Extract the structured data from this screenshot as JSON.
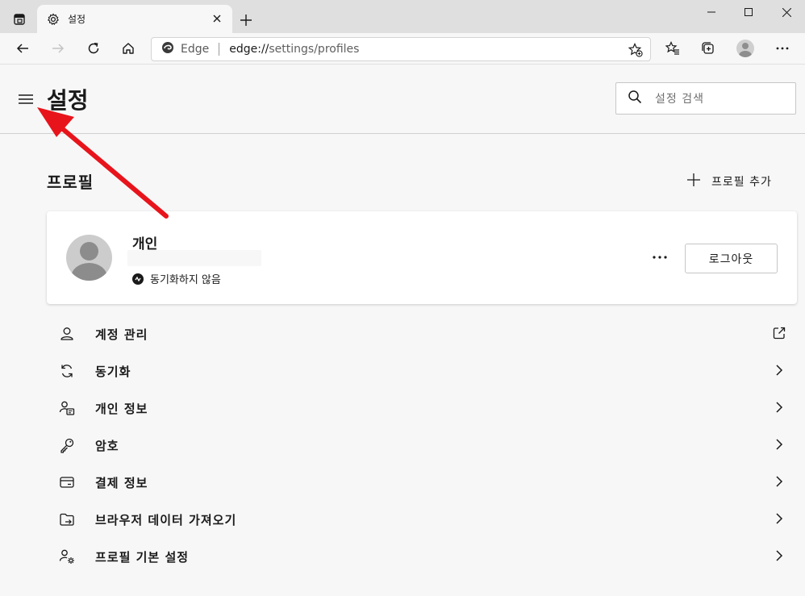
{
  "browser": {
    "tab": {
      "title": "설정"
    },
    "address": {
      "site_name": "Edge",
      "url_scheme": "edge://",
      "url_path": "settings/profiles"
    }
  },
  "header": {
    "title": "설정",
    "search_placeholder": "설정 검색"
  },
  "profiles": {
    "section_title": "프로필",
    "add_label": "프로필 추가",
    "card": {
      "name": "개인",
      "sync_status": "동기화하지 않음",
      "logout_label": "로그아웃"
    },
    "items": [
      {
        "label": "계정 관리",
        "icon": "account-icon",
        "action": "external-link-icon"
      },
      {
        "label": "동기화",
        "icon": "sync-icon",
        "action": "chevron-right-icon"
      },
      {
        "label": "개인 정보",
        "icon": "personal-info-icon",
        "action": "chevron-right-icon"
      },
      {
        "label": "암호",
        "icon": "key-icon",
        "action": "chevron-right-icon"
      },
      {
        "label": "결제 정보",
        "icon": "card-icon",
        "action": "chevron-right-icon"
      },
      {
        "label": "브라우저 데이터 가져오기",
        "icon": "import-folder-icon",
        "action": "chevron-right-icon"
      },
      {
        "label": "프로필 기본 설정",
        "icon": "profile-settings-icon",
        "action": "chevron-right-icon"
      }
    ]
  },
  "colors": {
    "annotation_arrow": "#e8141c",
    "page_bg": "#f7f7f7",
    "titlebar_bg": "#dfdfdf"
  }
}
